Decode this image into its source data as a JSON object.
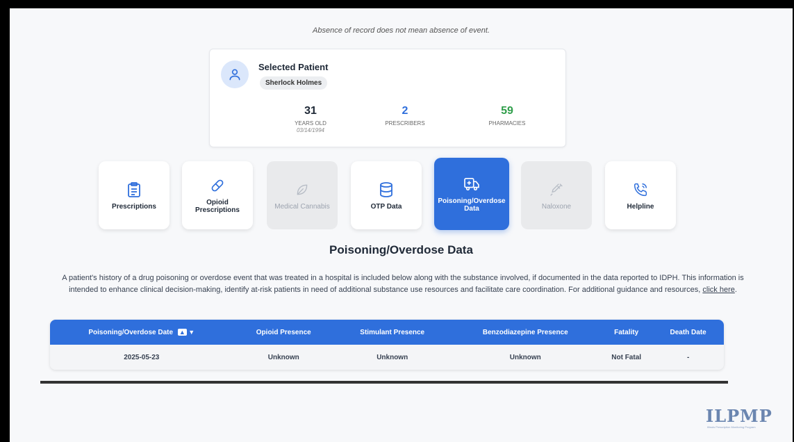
{
  "disclaimer": "Absence of record does not mean absence of event.",
  "patient": {
    "heading": "Selected Patient",
    "name": "Sherlock Holmes",
    "age": "31",
    "age_label": "YEARS OLD",
    "dob": "03/14/1994",
    "prescribers": "2",
    "prescribers_label": "PRESCRIBERS",
    "pharmacies": "59",
    "pharmacies_label": "PHARMACIES"
  },
  "tiles": [
    {
      "label": "Prescriptions",
      "icon": "clipboard-icon",
      "state": "normal"
    },
    {
      "label": "Opioid Prescriptions",
      "icon": "pill-icon",
      "state": "normal"
    },
    {
      "label": "Medical Cannabis",
      "icon": "leaf-icon",
      "state": "disabled"
    },
    {
      "label": "OTP Data",
      "icon": "database-icon",
      "state": "normal"
    },
    {
      "label": "Poisoning/Overdose Data",
      "icon": "ambulance-icon",
      "state": "active"
    },
    {
      "label": "Naloxone",
      "icon": "syringe-icon",
      "state": "disabled"
    },
    {
      "label": "Helpline",
      "icon": "phone-icon",
      "state": "normal"
    }
  ],
  "section": {
    "title": "Poisoning/Overdose Data",
    "description": "A patient's history of a drug poisoning or overdose event that was treated in a hospital is included below along with the substance involved, if documented in the data reported to IDPH. This information is intended to enhance clinical decision-making, identify at-risk patients in need of additional substance use resources and facilitate care coordination. For additional guidance and resources, ",
    "link_text": "click here",
    "suffix": "."
  },
  "table": {
    "headers": [
      "Poisoning/Overdose Date",
      "Opioid Presence",
      "Stimulant Presence",
      "Benzodiazepine Presence",
      "Fatality",
      "Death Date"
    ],
    "sort_up": "▲",
    "sort_down": "▼",
    "rows": [
      [
        "2025-05-23",
        "Unknown",
        "Unknown",
        "Unknown",
        "Not Fatal",
        "-"
      ]
    ]
  },
  "logo": {
    "text": "ILPMP",
    "tagline": "Illinois Prescription Monitoring Program"
  },
  "colors": {
    "primary": "#2f6fdc",
    "pharmacies": "#2f9e4a",
    "disabled": "#e9eaec"
  }
}
